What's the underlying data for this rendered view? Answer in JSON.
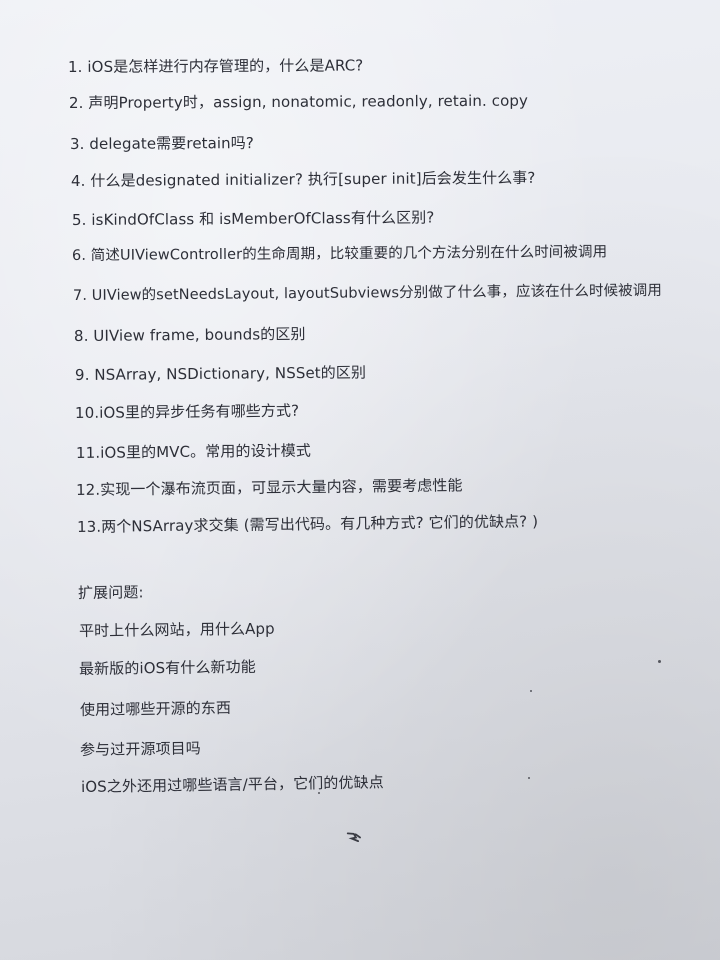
{
  "questions": [
    "1. iOS是怎样进行内存管理的，什么是ARC?",
    "2. 声明Property时，assign, nonatomic, readonly, retain. copy",
    "3. delegate需要retain吗?",
    "4. 什么是designated initializer? 执行[super init]后会发生什么事?",
    "5. isKindOfClass 和 isMemberOfClass有什么区别?",
    "6. 简述UIViewController的生命周期，比较重要的几个方法分别在什么时间被调用",
    "7. UIView的setNeedsLayout, layoutSubviews分别做了什么事，应该在什么时候被调用",
    "8. UIView frame, bounds的区别",
    "9. NSArray, NSDictionary, NSSet的区别",
    "10.iOS里的异步任务有哪些方式?",
    "11.iOS里的MVC。常用的设计模式",
    "12.实现一个瀑布流页面，可显示大量内容，需要考虑性能",
    "13.两个NSArray求交集 (需写出代码。有几种方式? 它们的优缺点? )"
  ],
  "extended": {
    "heading": "扩展问题:",
    "items": [
      "平时上什么网站，用什么App",
      "最新版的iOS有什么新功能",
      "使用过哪些开源的东西",
      "参与过开源项目吗",
      "iOS之外还用过哪些语言/平台，它们的优缺点"
    ]
  }
}
